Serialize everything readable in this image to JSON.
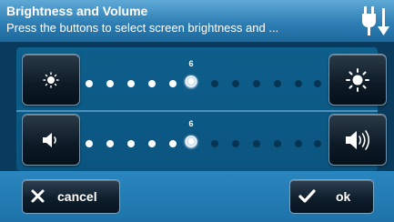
{
  "header": {
    "title": "Brightness and Volume",
    "subtitle": "Press the buttons to select screen brightness and ...",
    "icon": "power-plug-icon"
  },
  "brightness": {
    "level_label": "6",
    "level_fraction": 0.5,
    "decrease_icon": "brightness-low-icon",
    "increase_icon": "brightness-high-icon"
  },
  "volume": {
    "level_label": "6",
    "level_fraction": 0.5,
    "decrease_icon": "volume-low-icon",
    "increase_icon": "volume-high-icon"
  },
  "footer": {
    "cancel_label": "cancel",
    "ok_label": "ok",
    "cancel_icon": "x-icon",
    "ok_icon": "checkmark-icon"
  },
  "colors": {
    "header": "#2e7fb5",
    "panel": "#0e5f8c",
    "footer": "#2a86bf",
    "dot_on": "#ffffff",
    "dot_off": "#063554"
  }
}
